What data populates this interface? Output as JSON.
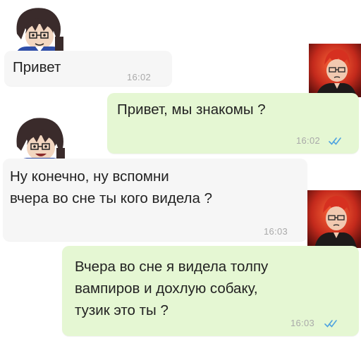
{
  "messages": [
    {
      "sender": "incoming",
      "text": "Привет",
      "time": "16:02"
    },
    {
      "sender": "outgoing",
      "text": "Привет, мы знакомы ?",
      "time": "16:02",
      "status": "read"
    },
    {
      "sender": "incoming",
      "text": "Ну конечно, ну вспомни\nвчера во сне ты кого видела ?",
      "time": "16:03"
    },
    {
      "sender": "outgoing",
      "text": "Вчера во сне я видела толпу\nвампиров и дохлую собаку,\nтузик это ты ?",
      "time": "16:03",
      "status": "read"
    }
  ],
  "colors": {
    "incoming_bubble": "#f6f6f6",
    "outgoing_bubble": "#e5f7d3",
    "read_ticks": "#4fa3e0",
    "time_text": "#a9a9a9"
  },
  "icons": {
    "incoming_avatar": "brown-haired-girl-avatar",
    "outgoing_avatar": "red-haired-man-avatar",
    "read_status": "double-check-icon"
  }
}
